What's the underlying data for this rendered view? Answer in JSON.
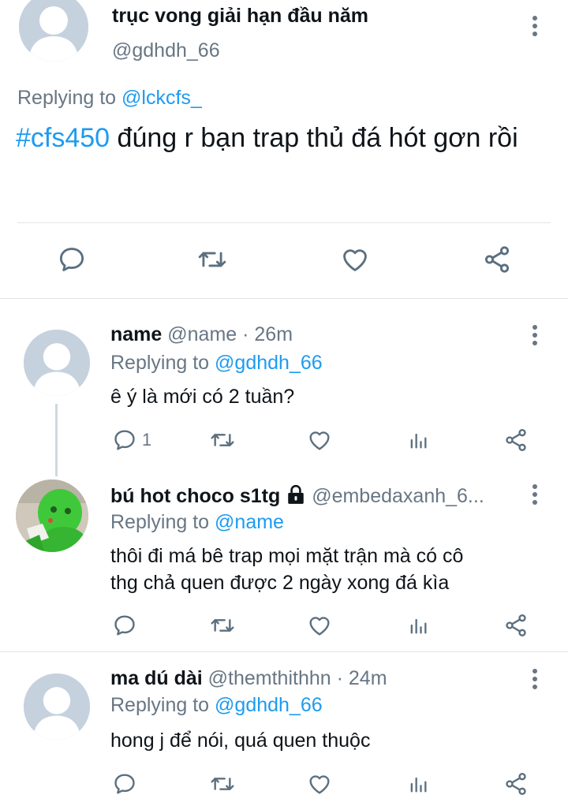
{
  "main_tweet": {
    "display_name": "trục vong giải hạn đầu năm",
    "handle": "@gdhdh_66",
    "replying_label": "Replying to",
    "replying_to": "@lckcfs_",
    "hashtag": "#cfs450",
    "text": " đúng r bạn trap thủ đá hót gơn rồi"
  },
  "replies": [
    {
      "display_name": "name",
      "handle": "@name",
      "time": " · 26m",
      "replying_label": "Replying to",
      "replying_to": "@gdhdh_66",
      "text": "ê ý là mới có 2 tuần?",
      "reply_count": "1",
      "avatar": "default-avatar-icon"
    },
    {
      "display_name": "bú hot choco s1tg",
      "handle": "@embedaxanh_6...",
      "replying_label": "Replying to",
      "replying_to": "@name",
      "text_line1": "thôi đi má bê trap mọi mặt trận mà có cô",
      "text_line2": "thg chả quen được 2 ngày xong đá kìa",
      "avatar": "green-character-avatar"
    },
    {
      "display_name": "ma dú dài",
      "handle": "@themthithhn",
      "time": " · 24m",
      "replying_label": "Replying to",
      "replying_to": "@gdhdh_66",
      "text": "hong j để nói, quá quen thuộc",
      "avatar": "default-avatar-icon"
    }
  ],
  "colors": {
    "link": "#1d9bf0",
    "secondary": "#687684",
    "divider": "#e1e6ea",
    "icon": "#5b6f7f"
  }
}
